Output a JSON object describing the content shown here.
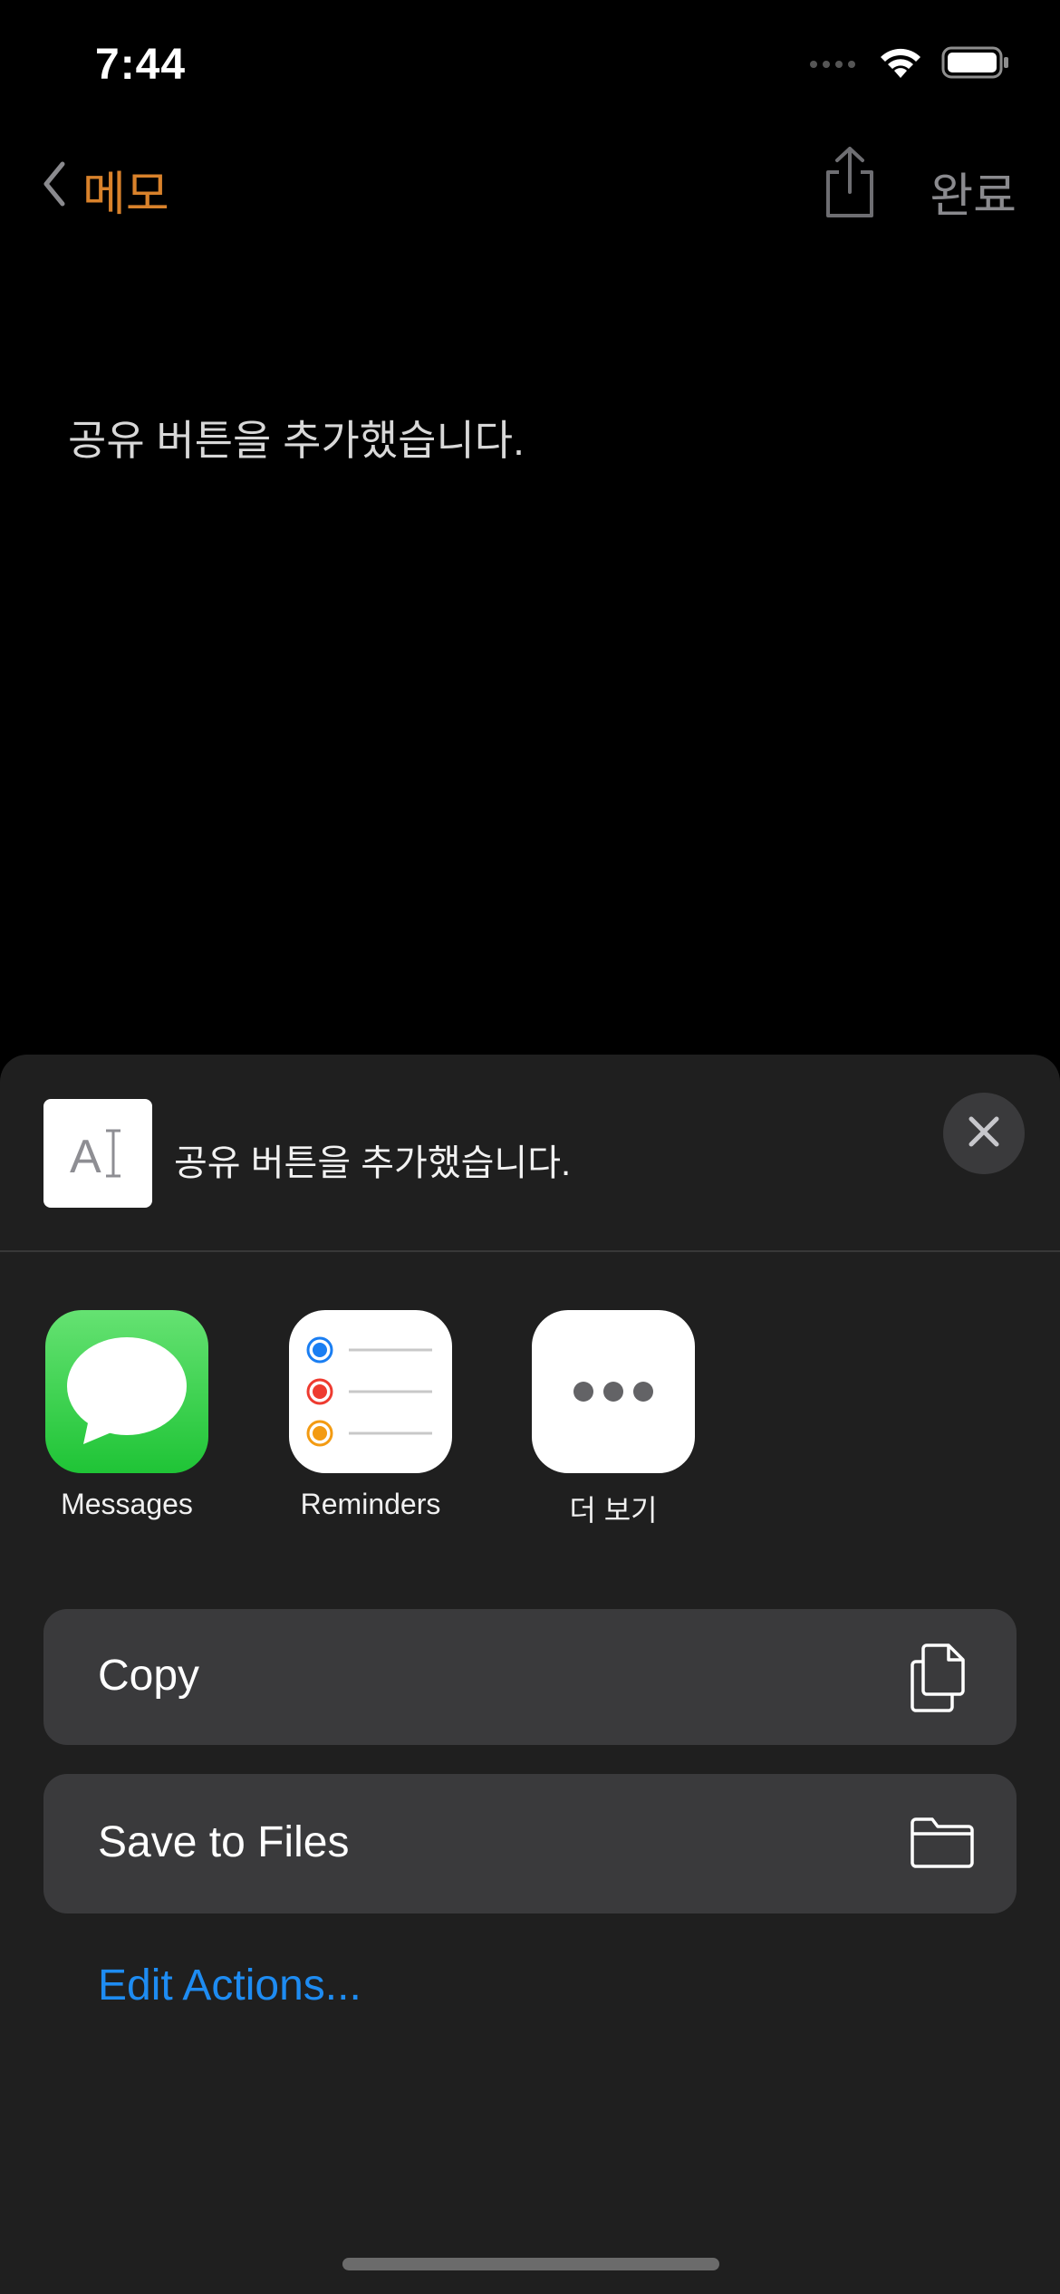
{
  "status_bar": {
    "time": "7:44",
    "icons": [
      "cellular-signal-icon",
      "wifi-icon",
      "battery-icon"
    ]
  },
  "nav": {
    "back_label": "메모",
    "done_label": "완료",
    "accent_color": "#d9822b",
    "icons": [
      "chevron-left-icon",
      "share-icon"
    ]
  },
  "note": {
    "body": "공유 버튼을 추가했습니다."
  },
  "share_sheet": {
    "preview": {
      "thumb_glyph": "A",
      "title": "공유 버튼을 추가했습니다."
    },
    "apps": [
      {
        "label": "Messages",
        "icon": "messages-icon"
      },
      {
        "label": "Reminders",
        "icon": "reminders-icon"
      },
      {
        "label": "더 보기",
        "icon": "more-icon"
      }
    ],
    "actions": [
      {
        "label": "Copy",
        "icon": "copy-icon"
      },
      {
        "label": "Save to Files",
        "icon": "folder-icon"
      }
    ],
    "edit_actions_label": "Edit Actions...",
    "link_color": "#1e8cf2"
  }
}
